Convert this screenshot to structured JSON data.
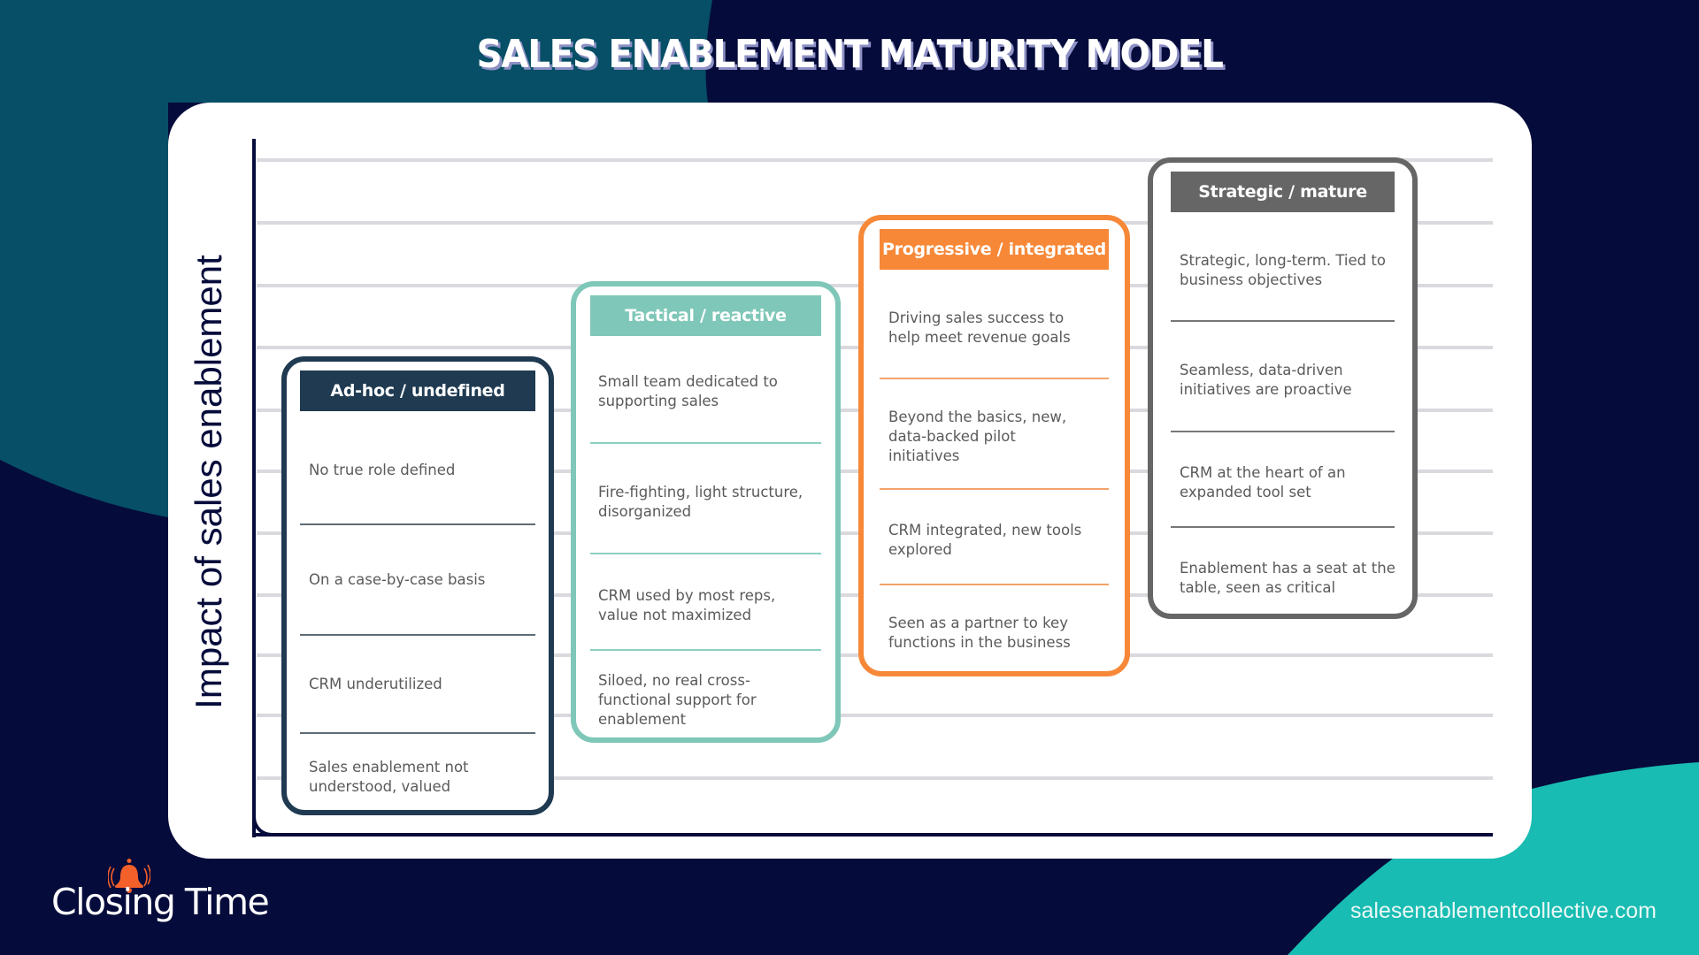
{
  "title": "SALES ENABLEMENT MATURITY MODEL",
  "y_axis_label": "Impact of sales enablement",
  "colors": {
    "background": "#050b3a",
    "teal_dark": "#064f66",
    "teal_bright": "#18bcb2",
    "panel": "#ffffff",
    "gridline": "#d9d9de"
  },
  "stages": [
    {
      "name": "Ad-hoc / undefined",
      "level": 1,
      "color": "#1f3a51",
      "divider_color": "#5f6b73",
      "items": [
        "No true role defined",
        "On a case-by-case basis",
        "CRM underutilized",
        "Sales enablement not understood, valued"
      ]
    },
    {
      "name": "Tactical / reactive",
      "level": 2,
      "color": "#7fc7b8",
      "divider_color": "#8ccfc1",
      "items": [
        "Small team dedicated to supporting sales",
        "Fire-fighting, light structure, disorganized",
        "CRM used by most reps, value not maximized",
        "Siloed, no real cross-functional support for enablement"
      ]
    },
    {
      "name": "Progressive / integrated",
      "level": 3,
      "color": "#f68838",
      "divider_color": "#f3a36a",
      "items": [
        "Driving sales success to help meet revenue goals",
        "Beyond the basics, new, data-backed pilot initiatives",
        "CRM integrated, new tools explored",
        "Seen as a partner to key functions in the business"
      ]
    },
    {
      "name": "Strategic / mature",
      "level": 4,
      "color": "#666666",
      "divider_color": "#777777",
      "items": [
        "Strategic, long-term. Tied to business objectives",
        "Seamless, data-driven initiatives are proactive",
        "CRM at the heart of an expanded tool set",
        "Enablement has a seat at the table, seen as critical"
      ]
    }
  ],
  "footer": {
    "logo_text": "Closing Time",
    "logo_icon": "bell-ringing-icon",
    "website": "salesenablementcollective.com"
  }
}
